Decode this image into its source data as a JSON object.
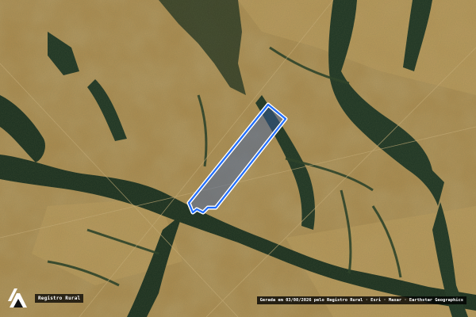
{
  "map": {
    "imagery": "satellite",
    "feature_outline_color": "#1f6dff",
    "feature_fill_color": "#3a5fa8"
  },
  "branding": {
    "logo_icon": "registro-rural-logo-icon",
    "name": "Registro Rural"
  },
  "attribution": {
    "text": "Gerada em 03/08/2026 pelo Registro Rural · Esri · Maxar · Earthstar Geographics"
  }
}
